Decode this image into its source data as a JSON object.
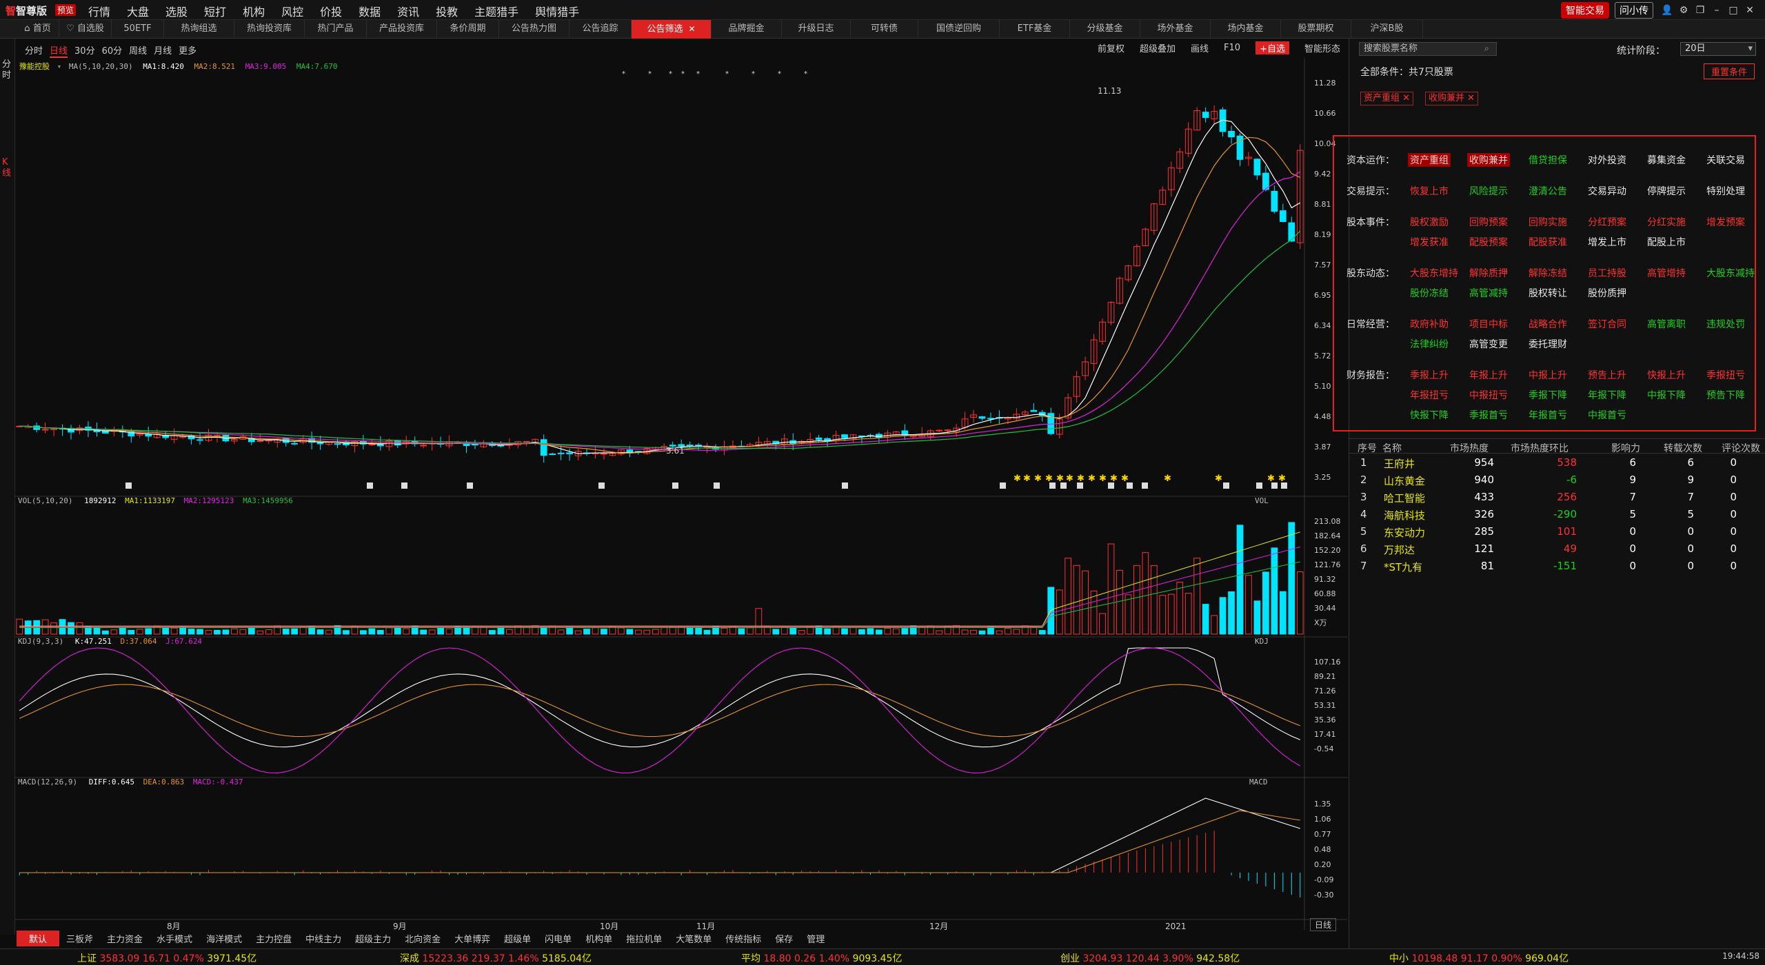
{
  "app": {
    "logo": "智尊版",
    "version_badge": "预览"
  },
  "menu": [
    "行情",
    "大盘",
    "选股",
    "短打",
    "机构",
    "风控",
    "价投",
    "数据",
    "资讯",
    "投教",
    "主题猎手",
    "舆情猎手"
  ],
  "topright": {
    "smart_trade": "智能交易",
    "ask_label": "问小传",
    "time": "19:44:58"
  },
  "tabs": [
    "首页",
    "自选股",
    "50ETF",
    "热询组选",
    "热询投资库",
    "热门产品",
    "产品投资库",
    "条价周期",
    "公告热力图",
    "公告追踪",
    "公告筛选",
    "品牌掘金",
    "升级日志",
    "可转债",
    "国债逆回购",
    "ETF基金",
    "分级基金",
    "场外基金",
    "场内基金",
    "股票期权",
    "沪深B股"
  ],
  "active_tab_index": 10,
  "left_strip": {
    "fenshi": "分时",
    "kxian": "K线"
  },
  "chart_toolbar": {
    "periods": [
      "分时",
      "日线",
      "30分",
      "60分",
      "周线",
      "月线",
      "更多"
    ],
    "selected_period": "日线",
    "right": [
      "前复权",
      "超级叠加",
      "画线",
      "F10",
      "+自选",
      "智能形态"
    ]
  },
  "price_panel": {
    "name": "豫能控股",
    "ma_label": "MA(5,10,20,30)",
    "ma1": "MA1:8.420",
    "ma2": "MA2:8.521",
    "ma3": "MA3:9.005",
    "ma4": "MA4:7.670",
    "high_label": "11.13",
    "low_label": "3.61",
    "axis": [
      "11.28",
      "10.66",
      "10.04",
      "9.42",
      "8.81",
      "8.19",
      "7.57",
      "6.95",
      "6.34",
      "5.72",
      "5.10",
      "4.48",
      "3.87",
      "3.25"
    ],
    "colors": {
      "up": "#ff3030",
      "down": "#00e5ff",
      "ma1": "#ffffff",
      "ma2": "#e69520",
      "ma3": "#e020e0",
      "ma4": "#20c040"
    }
  },
  "vol_panel": {
    "label": "VOL(5,10,20)",
    "value": "1892912",
    "ma1": "MA1:1133197",
    "ma2": "MA2:1295123",
    "ma3": "MA3:1459956",
    "tag": "VOL",
    "axis": [
      "213.08",
      "182.64",
      "152.20",
      "121.76",
      "91.32",
      "60.88",
      "30.44",
      "X万"
    ]
  },
  "kdj_panel": {
    "label": "KDJ(9,3,3)",
    "k": "K:47.251",
    "d": "D:37.064",
    "j": "J:67.624",
    "tag": "KDJ",
    "axis": [
      "107.16",
      "89.21",
      "71.26",
      "53.31",
      "35.36",
      "17.41",
      "-0.54"
    ]
  },
  "macd_panel": {
    "label": "MACD(12,26,9)",
    "diff": "DIFF:0.645",
    "dea": "DEA:0.863",
    "macd": "MACD:-0.437",
    "tag": "MACD",
    "axis": [
      "1.35",
      "1.06",
      "0.77",
      "0.48",
      "0.20",
      "-0.09",
      "-0.30"
    ]
  },
  "x_axis": [
    "8月",
    "9月",
    "10月",
    "11月",
    "12月",
    "2021"
  ],
  "x_axis_right": "日线",
  "bottom_tabs": [
    "默认",
    "三板斧",
    "主力资金",
    "水手模式",
    "海洋模式",
    "主力控盘",
    "中线主力",
    "超级主力",
    "北向资金",
    "大单博弈",
    "超级单",
    "闪电单",
    "机构单",
    "拖拉机单",
    "大笔数单",
    "传统指标",
    "保存",
    "管理"
  ],
  "status": [
    {
      "name": "上证",
      "price": "3583.09",
      "chg": "16.71",
      "pct": "0.47%",
      "amt": "3971.45亿"
    },
    {
      "name": "深成",
      "price": "15223.36",
      "chg": "219.37",
      "pct": "1.46%",
      "amt": "5185.04亿"
    },
    {
      "name": "平均",
      "price": "18.80",
      "chg": "0.26",
      "pct": "1.40%",
      "amt": "9093.45亿"
    },
    {
      "name": "创业",
      "price": "3204.93",
      "chg": "120.44",
      "pct": "3.90%",
      "amt": "942.58亿"
    },
    {
      "name": "中小",
      "price": "10198.48",
      "chg": "91.17",
      "pct": "0.90%",
      "amt": "969.04亿"
    }
  ],
  "right_panel": {
    "search_placeholder": "搜索股票名称",
    "stat_label": "统计阶段：",
    "stat_value": "20日",
    "all_conditions": "全部条件：共7只股票",
    "reset": "重置条件",
    "chips": [
      "资产重组",
      "收购兼并"
    ],
    "categories": [
      {
        "title": "资本运作：",
        "items": [
          [
            "资产重组",
            "sel"
          ],
          [
            "收购兼并",
            "sel"
          ],
          [
            "借贷担保",
            "green"
          ],
          [
            "对外投资",
            "white"
          ],
          [
            "募集资金",
            "white"
          ],
          [
            "关联交易",
            "white"
          ]
        ]
      },
      {
        "title": "交易提示：",
        "items": [
          [
            "恢复上市",
            "red"
          ],
          [
            "风险提示",
            "green"
          ],
          [
            "澄清公告",
            "green"
          ],
          [
            "交易异动",
            "white"
          ],
          [
            "停牌提示",
            "white"
          ],
          [
            "特别处理",
            "white"
          ]
        ]
      },
      {
        "title": "股本事件：",
        "items": [
          [
            "股权激励",
            "red"
          ],
          [
            "回购预案",
            "red"
          ],
          [
            "回购实施",
            "red"
          ],
          [
            "分红预案",
            "red"
          ],
          [
            "分红实施",
            "red"
          ],
          [
            "增发预案",
            "red"
          ],
          [
            "增发获准",
            "red"
          ],
          [
            "配股预案",
            "red"
          ],
          [
            "配股获准",
            "red"
          ],
          [
            "增发上市",
            "white"
          ],
          [
            "配股上市",
            "white"
          ]
        ]
      },
      {
        "title": "股东动态：",
        "items": [
          [
            "大股东增持",
            "red"
          ],
          [
            "解除质押",
            "red"
          ],
          [
            "解除冻结",
            "red"
          ],
          [
            "员工持股",
            "red"
          ],
          [
            "高管增持",
            "red"
          ],
          [
            "大股东减持",
            "green"
          ],
          [
            "股份冻结",
            "green"
          ],
          [
            "高管减持",
            "green"
          ],
          [
            "股权转让",
            "white"
          ],
          [
            "股份质押",
            "white"
          ]
        ]
      },
      {
        "title": "日常经营：",
        "items": [
          [
            "政府补助",
            "red"
          ],
          [
            "项目中标",
            "red"
          ],
          [
            "战略合作",
            "red"
          ],
          [
            "签订合同",
            "red"
          ],
          [
            "高管离职",
            "green"
          ],
          [
            "违规处罚",
            "green"
          ],
          [
            "法律纠纷",
            "green"
          ],
          [
            "高管变更",
            "white"
          ],
          [
            "委托理财",
            "white"
          ]
        ]
      },
      {
        "title": "财务报告：",
        "items": [
          [
            "季报上升",
            "red"
          ],
          [
            "年报上升",
            "red"
          ],
          [
            "中报上升",
            "red"
          ],
          [
            "预告上升",
            "red"
          ],
          [
            "快报上升",
            "red"
          ],
          [
            "季报扭亏",
            "red"
          ],
          [
            "年报扭亏",
            "red"
          ],
          [
            "中报扭亏",
            "red"
          ],
          [
            "季报下降",
            "green"
          ],
          [
            "年报下降",
            "green"
          ],
          [
            "中报下降",
            "green"
          ],
          [
            "预告下降",
            "green"
          ],
          [
            "快报下降",
            "green"
          ],
          [
            "季报首亏",
            "green"
          ],
          [
            "年报首亏",
            "green"
          ],
          [
            "中报首亏",
            "green"
          ]
        ]
      }
    ],
    "table": {
      "headers": [
        "序号",
        "名称",
        "市场热度",
        "市场热度环比",
        "影响力",
        "转载次数",
        "评论次数"
      ],
      "rows": [
        {
          "no": "1",
          "name": "王府井",
          "heat": "954",
          "change": "538",
          "dir": "up",
          "influence": "6",
          "reposts": "6",
          "comments": "0"
        },
        {
          "no": "2",
          "name": "山东黄金",
          "heat": "940",
          "change": "-6",
          "dir": "down",
          "influence": "9",
          "reposts": "9",
          "comments": "0"
        },
        {
          "no": "3",
          "name": "哈工智能",
          "heat": "433",
          "change": "256",
          "dir": "up",
          "influence": "7",
          "reposts": "7",
          "comments": "0"
        },
        {
          "no": "4",
          "name": "海航科技",
          "heat": "326",
          "change": "-290",
          "dir": "down",
          "influence": "5",
          "reposts": "5",
          "comments": "0"
        },
        {
          "no": "5",
          "name": "东安动力",
          "heat": "285",
          "change": "101",
          "dir": "up",
          "influence": "0",
          "reposts": "0",
          "comments": "0"
        },
        {
          "no": "6",
          "name": "万邦达",
          "heat": "121",
          "change": "49",
          "dir": "up",
          "influence": "0",
          "reposts": "0",
          "comments": "0"
        },
        {
          "no": "7",
          "name": "*ST九有",
          "heat": "81",
          "change": "-151",
          "dir": "down",
          "influence": "0",
          "reposts": "0",
          "comments": "0"
        }
      ]
    }
  }
}
